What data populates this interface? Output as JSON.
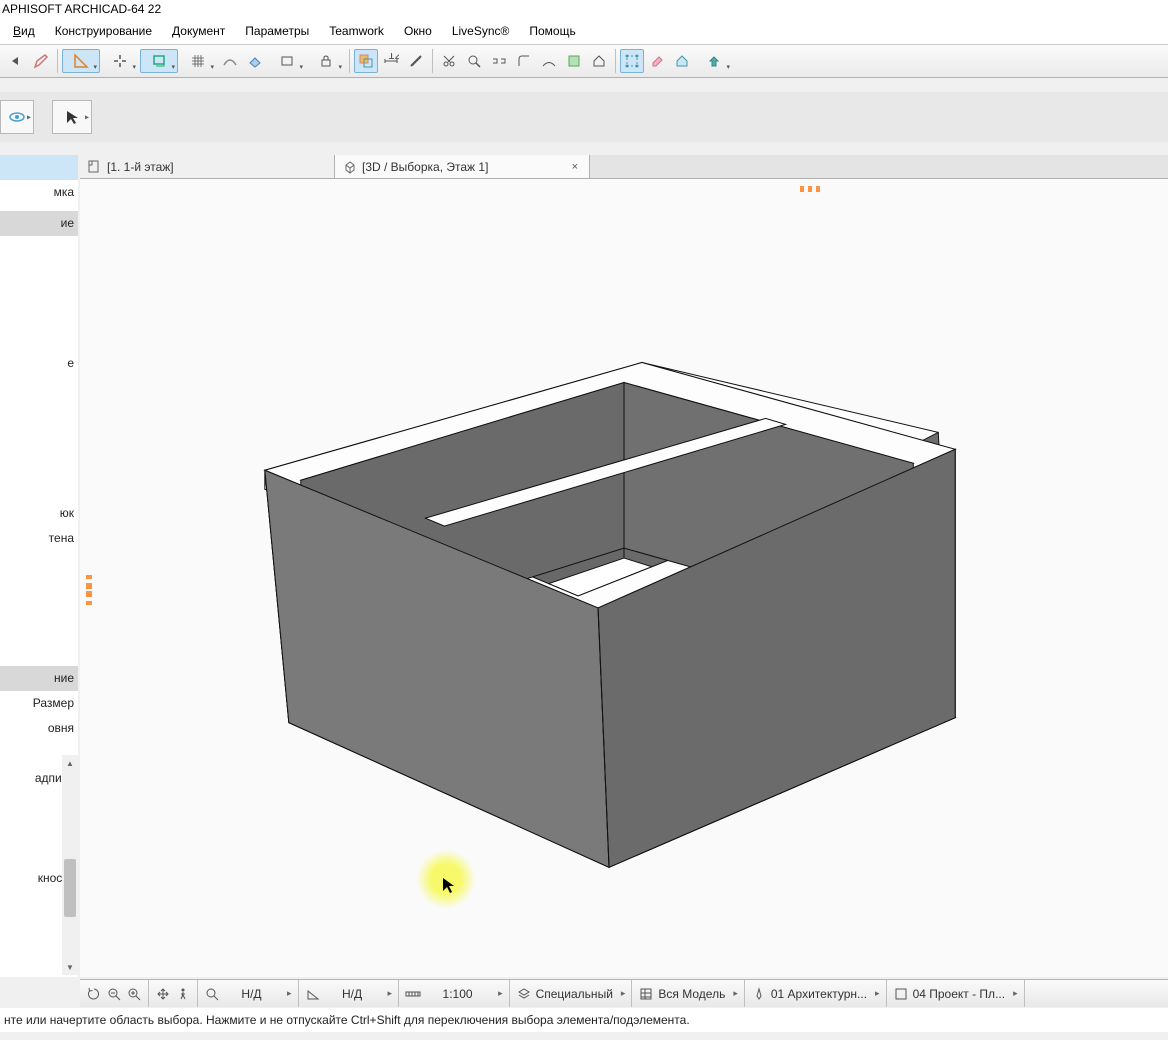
{
  "app_title": "APHISOFT ARCHICAD-64 22",
  "menu": {
    "view": "Вид",
    "design": "Конструирование",
    "document": "Документ",
    "options": "Параметры",
    "teamwork": "Teamwork",
    "window": "Окно",
    "livesync": "LiveSync®",
    "help": "Помощь"
  },
  "sidebar": {
    "items": [
      {
        "label": "",
        "type": "highlighted"
      },
      {
        "label": "мка",
        "type": "normal"
      },
      {
        "label": "ие",
        "type": "header"
      }
    ],
    "mid_items": [
      {
        "label": "е"
      },
      {
        "label": ""
      }
    ],
    "more_items": [
      {
        "label": "юк"
      },
      {
        "label": "тена"
      }
    ],
    "section2_header": "ние",
    "section2_items": [
      {
        "label": "Размер"
      },
      {
        "label": "овня"
      },
      {
        "label": ""
      },
      {
        "label": "адпись"
      },
      {
        "label": ""
      },
      {
        "label": ""
      },
      {
        "label": ""
      },
      {
        "label": "кность"
      }
    ]
  },
  "tabs": {
    "tab1": "[1. 1-й этаж]",
    "tab2": "[3D / Выборка, Этаж 1]"
  },
  "statusbar": {
    "nd1": "Н/Д",
    "nd2": "Н/Д",
    "scale": "1:100",
    "special": "Специальный",
    "model": "Вся Модель",
    "arch": "01 Архитектурн...",
    "project": "04 Проект - Пл..."
  },
  "hint": "нте или начертите область выбора. Нажмите и не отпускайте Ctrl+Shift для переключения выбора элемента/подэлемента."
}
